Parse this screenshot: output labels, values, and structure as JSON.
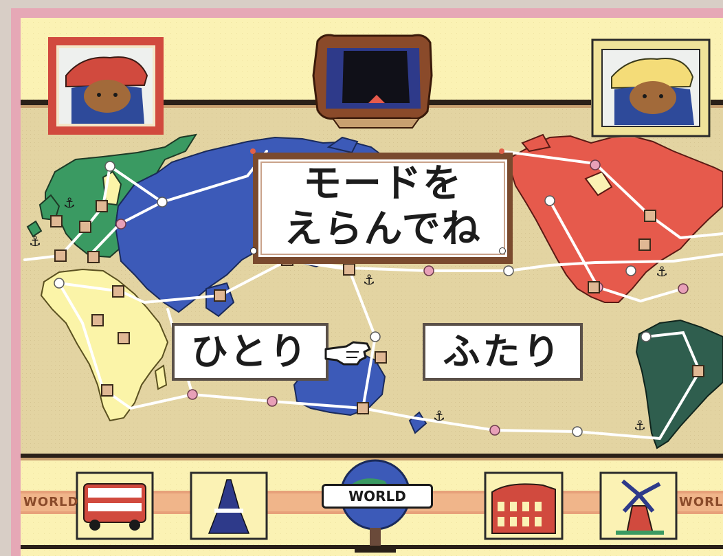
{
  "title": {
    "line1": "モードを",
    "line2": "えらんでね"
  },
  "options": {
    "single": "ひとり",
    "two": "ふたり"
  },
  "banner_text": "WORLD",
  "icons": {
    "portrait_left": "bear-red-hat-portrait-icon",
    "portrait_right": "bear-yellow-hat-portrait-icon",
    "mirror": "ornate-mirror-frame-icon",
    "globe": "world-globe-icon",
    "pointer": "pointing-hand-cursor-icon",
    "landmark_1": "double-decker-bus-icon",
    "landmark_2": "eiffel-tower-icon",
    "landmark_3": "colosseum-icon",
    "landmark_4": "windmill-icon"
  },
  "colors": {
    "background_wall": "#fbf2b4",
    "map_sea": "#e6d8a8",
    "europe": "#3a9a62",
    "asia": "#3c5ab8",
    "africa": "#fbf4a8",
    "north_america": "#e65a4c",
    "south_america": "#2f5e4e",
    "oceania": "#3c5ab8",
    "frame_border": "#e3a6b6"
  }
}
